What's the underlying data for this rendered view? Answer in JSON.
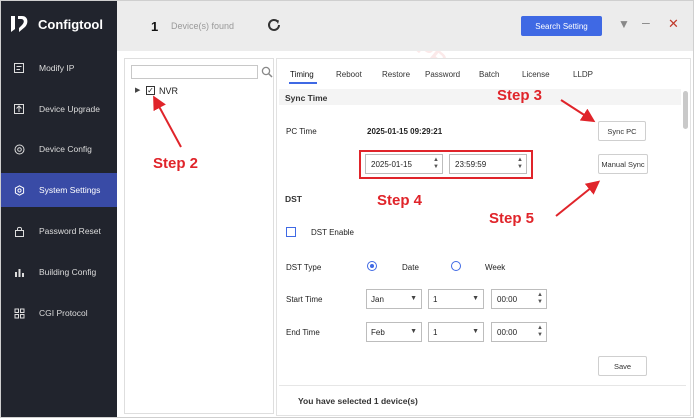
{
  "app": {
    "title": "Configtool"
  },
  "sidebar": {
    "items": [
      {
        "label": "Modify IP",
        "icon": "edit-icon"
      },
      {
        "label": "Device Upgrade",
        "icon": "upgrade-icon"
      },
      {
        "label": "Device Config",
        "icon": "config-icon"
      },
      {
        "label": "System Settings",
        "icon": "settings-icon",
        "active": true
      },
      {
        "label": "Password Reset",
        "icon": "lock-icon"
      },
      {
        "label": "Building Config",
        "icon": "building-icon"
      },
      {
        "label": "CGI Protocol",
        "icon": "protocol-icon"
      }
    ]
  },
  "topbar": {
    "device_count": "1",
    "device_found_label": "Device(s) found",
    "search_button": "Search Setting",
    "refresh_icon": "refresh-icon"
  },
  "tree": {
    "search_placeholder": "",
    "nodes": [
      {
        "label": "NVR",
        "checked": true
      }
    ]
  },
  "tabs": [
    "Timing",
    "Reboot",
    "Restore",
    "Password",
    "Batch",
    "License",
    "LLDP"
  ],
  "sync_time": {
    "title": "Sync Time",
    "pc_time_label": "PC Time",
    "pc_time_value": "2025-01-15 09:29:21",
    "sync_pc_button": "Sync PC",
    "date_value": "2025-01-15",
    "time_value": "23:59:59",
    "manual_sync_button": "Manual Sync"
  },
  "dst": {
    "title": "DST",
    "enable_label": "DST Enable",
    "type_label": "DST Type",
    "type_options": [
      "Date",
      "Week"
    ],
    "type_selected": "Date",
    "start_label": "Start Time",
    "start_month": "Jan",
    "start_day": "1",
    "start_time": "00:00",
    "end_label": "End Time",
    "end_month": "Feb",
    "end_day": "1",
    "end_time": "00:00",
    "save_button": "Save"
  },
  "status": {
    "text": "You have selected 1 device(s)"
  },
  "annotations": {
    "step2": "Step 2",
    "step3": "Step 3",
    "step4": "Step 4",
    "step5": "Step 5"
  },
  "colors": {
    "sidebar_bg": "#21242d",
    "active_item": "#394ba6",
    "accent": "#3f69e4",
    "annotation": "#e0242a"
  }
}
